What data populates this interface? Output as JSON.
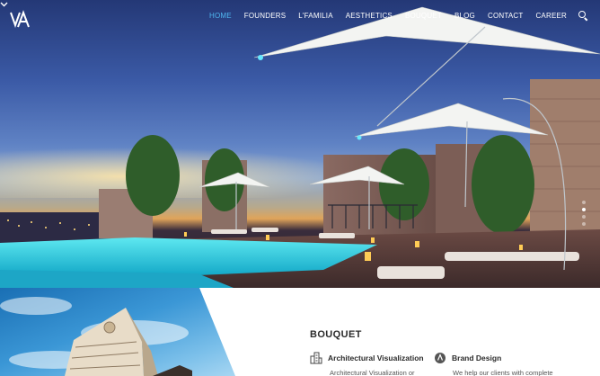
{
  "brand": {
    "logo_text": "VA"
  },
  "nav": {
    "items": [
      {
        "label": "HOME",
        "active": true
      },
      {
        "label": "FOUNDERS",
        "active": false
      },
      {
        "label": "L'FAMILIA",
        "active": false
      },
      {
        "label": "AESTHETICS",
        "active": false
      },
      {
        "label": "BOUQUET",
        "active": false
      },
      {
        "label": "BLOG",
        "active": false
      },
      {
        "label": "CONTACT",
        "active": false
      },
      {
        "label": "CAREER",
        "active": false
      }
    ],
    "search_icon": "search-icon",
    "active_color": "#4fb6f0"
  },
  "hero": {
    "slider_dots": 4,
    "active_dot": 1,
    "scroll_icon": "chevron-down-icon"
  },
  "section": {
    "title": "BOUQUET",
    "services": [
      {
        "icon": "building-icon",
        "title": "Architectural Visualization",
        "description": "Architectural Visualization or"
      },
      {
        "icon": "brand-icon",
        "title": "Brand Design",
        "description": "We help our clients with complete"
      }
    ]
  }
}
